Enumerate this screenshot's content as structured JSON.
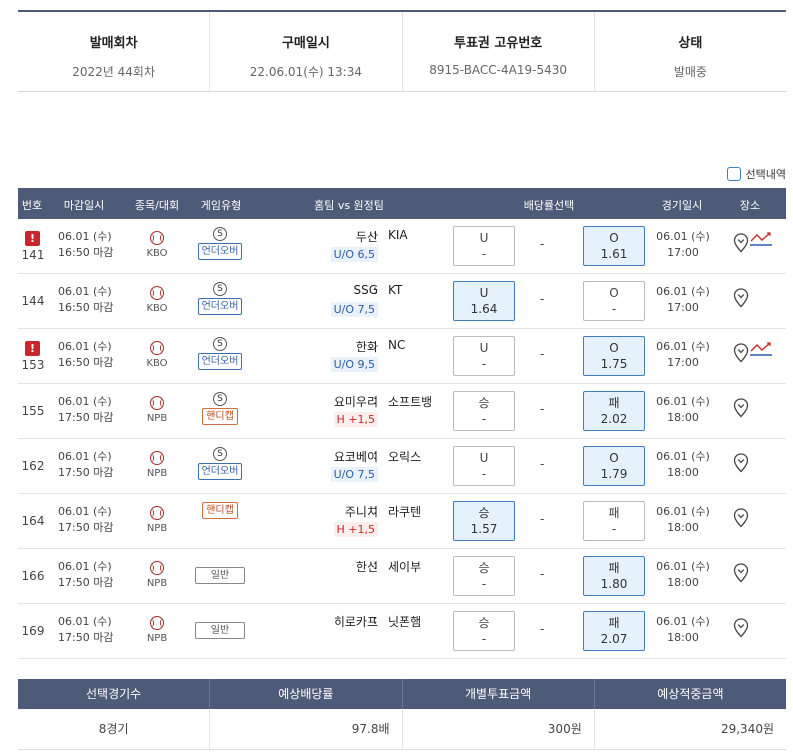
{
  "info": [
    {
      "label": "발매회차",
      "value": "2022년 44회차"
    },
    {
      "label": "구매일시",
      "value": "22.06.01(수) 13:34"
    },
    {
      "label": "투표권 고유번호",
      "value": "8915-BACC-4A19-5430"
    },
    {
      "label": "상태",
      "value": "발매중"
    }
  ],
  "select_label": "선택내역",
  "columns": [
    "번호",
    "마감일시",
    "종목/대회",
    "게임유형",
    "홈팀 vs 원정팀",
    "배당률선택",
    "경기일시",
    "장소"
  ],
  "rows": [
    {
      "no": "141",
      "warn": true,
      "d1": "06.01 (수)",
      "d2": "16:50 마감",
      "league": "KBO",
      "s": "S",
      "type": "언더오버",
      "type_class": "uo",
      "home": "두산",
      "sep": ":",
      "away": "KIA",
      "sub": "U/O 6,5",
      "sub_class": "uo",
      "l_label": "U",
      "l_val": "-",
      "l_on": false,
      "mid": "-",
      "r_label": "O",
      "r_val": "1.61",
      "r_on": true,
      "gd1": "06.01 (수)",
      "gd2": "17:00",
      "trend": true
    },
    {
      "no": "144",
      "warn": false,
      "d1": "06.01 (수)",
      "d2": "16:50 마감",
      "league": "KBO",
      "s": "S",
      "type": "언더오버",
      "type_class": "uo",
      "home": "SSG",
      "sep": ":",
      "away": "KT",
      "sub": "U/O 7,5",
      "sub_class": "uo",
      "l_label": "U",
      "l_val": "1.64",
      "l_on": true,
      "mid": "-",
      "r_label": "O",
      "r_val": "-",
      "r_on": false,
      "gd1": "06.01 (수)",
      "gd2": "17:00",
      "trend": false
    },
    {
      "no": "153",
      "warn": true,
      "d1": "06.01 (수)",
      "d2": "16:50 마감",
      "league": "KBO",
      "s": "S",
      "type": "언더오버",
      "type_class": "uo",
      "home": "한화",
      "sep": ":",
      "away": "NC",
      "sub": "U/O 9,5",
      "sub_class": "uo",
      "l_label": "U",
      "l_val": "-",
      "l_on": false,
      "mid": "-",
      "r_label": "O",
      "r_val": "1.75",
      "r_on": true,
      "gd1": "06.01 (수)",
      "gd2": "17:00",
      "trend": true
    },
    {
      "no": "155",
      "warn": false,
      "d1": "06.01 (수)",
      "d2": "17:50 마감",
      "league": "NPB",
      "s": "S",
      "type": "핸디캡",
      "type_class": "hc",
      "home": "요미우리",
      "sep": ":",
      "away": "소프트뱅",
      "sub": "H +1,5",
      "sub_class": "h",
      "l_label": "승",
      "l_val": "-",
      "l_on": false,
      "mid": "-",
      "r_label": "패",
      "r_val": "2.02",
      "r_on": true,
      "gd1": "06.01 (수)",
      "gd2": "18:00",
      "trend": false
    },
    {
      "no": "162",
      "warn": false,
      "d1": "06.01 (수)",
      "d2": "17:50 마감",
      "league": "NPB",
      "s": "S",
      "type": "언더오버",
      "type_class": "uo",
      "home": "요코베이",
      "sep": ":",
      "away": "오릭스",
      "sub": "U/O 7,5",
      "sub_class": "uo",
      "l_label": "U",
      "l_val": "-",
      "l_on": false,
      "mid": "-",
      "r_label": "O",
      "r_val": "1.79",
      "r_on": true,
      "gd1": "06.01 (수)",
      "gd2": "18:00",
      "trend": false
    },
    {
      "no": "164",
      "warn": false,
      "d1": "06.01 (수)",
      "d2": "17:50 마감",
      "league": "NPB",
      "s": "",
      "type": "핸디캡",
      "type_class": "hc",
      "home": "주니치",
      "sep": ":",
      "away": "라쿠텐",
      "sub": "H +1,5",
      "sub_class": "h",
      "l_label": "승",
      "l_val": "1.57",
      "l_on": true,
      "mid": "-",
      "r_label": "패",
      "r_val": "-",
      "r_on": false,
      "gd1": "06.01 (수)",
      "gd2": "18:00",
      "trend": false
    },
    {
      "no": "166",
      "warn": false,
      "d1": "06.01 (수)",
      "d2": "17:50 마감",
      "league": "NPB",
      "s": "",
      "type": "일반",
      "type_class": "gen",
      "home": "한신",
      "sep": ":",
      "away": "세이부",
      "sub": "",
      "sub_class": "",
      "l_label": "승",
      "l_val": "-",
      "l_on": false,
      "mid": "-",
      "r_label": "패",
      "r_val": "1.80",
      "r_on": true,
      "gd1": "06.01 (수)",
      "gd2": "18:00",
      "trend": false
    },
    {
      "no": "169",
      "warn": false,
      "d1": "06.01 (수)",
      "d2": "17:50 마감",
      "league": "NPB",
      "s": "",
      "type": "일반",
      "type_class": "gen",
      "home": "히로카프",
      "sep": ":",
      "away": "닛폰햄",
      "sub": "",
      "sub_class": "",
      "l_label": "승",
      "l_val": "-",
      "l_on": false,
      "mid": "-",
      "r_label": "패",
      "r_val": "2.07",
      "r_on": true,
      "gd1": "06.01 (수)",
      "gd2": "18:00",
      "trend": false
    }
  ],
  "summary": {
    "headers": [
      "선택경기수",
      "예상배당률",
      "개별투표금액",
      "예상적중금액"
    ],
    "values": [
      "8경기",
      "97.8배",
      "300원",
      "29,340원"
    ]
  }
}
